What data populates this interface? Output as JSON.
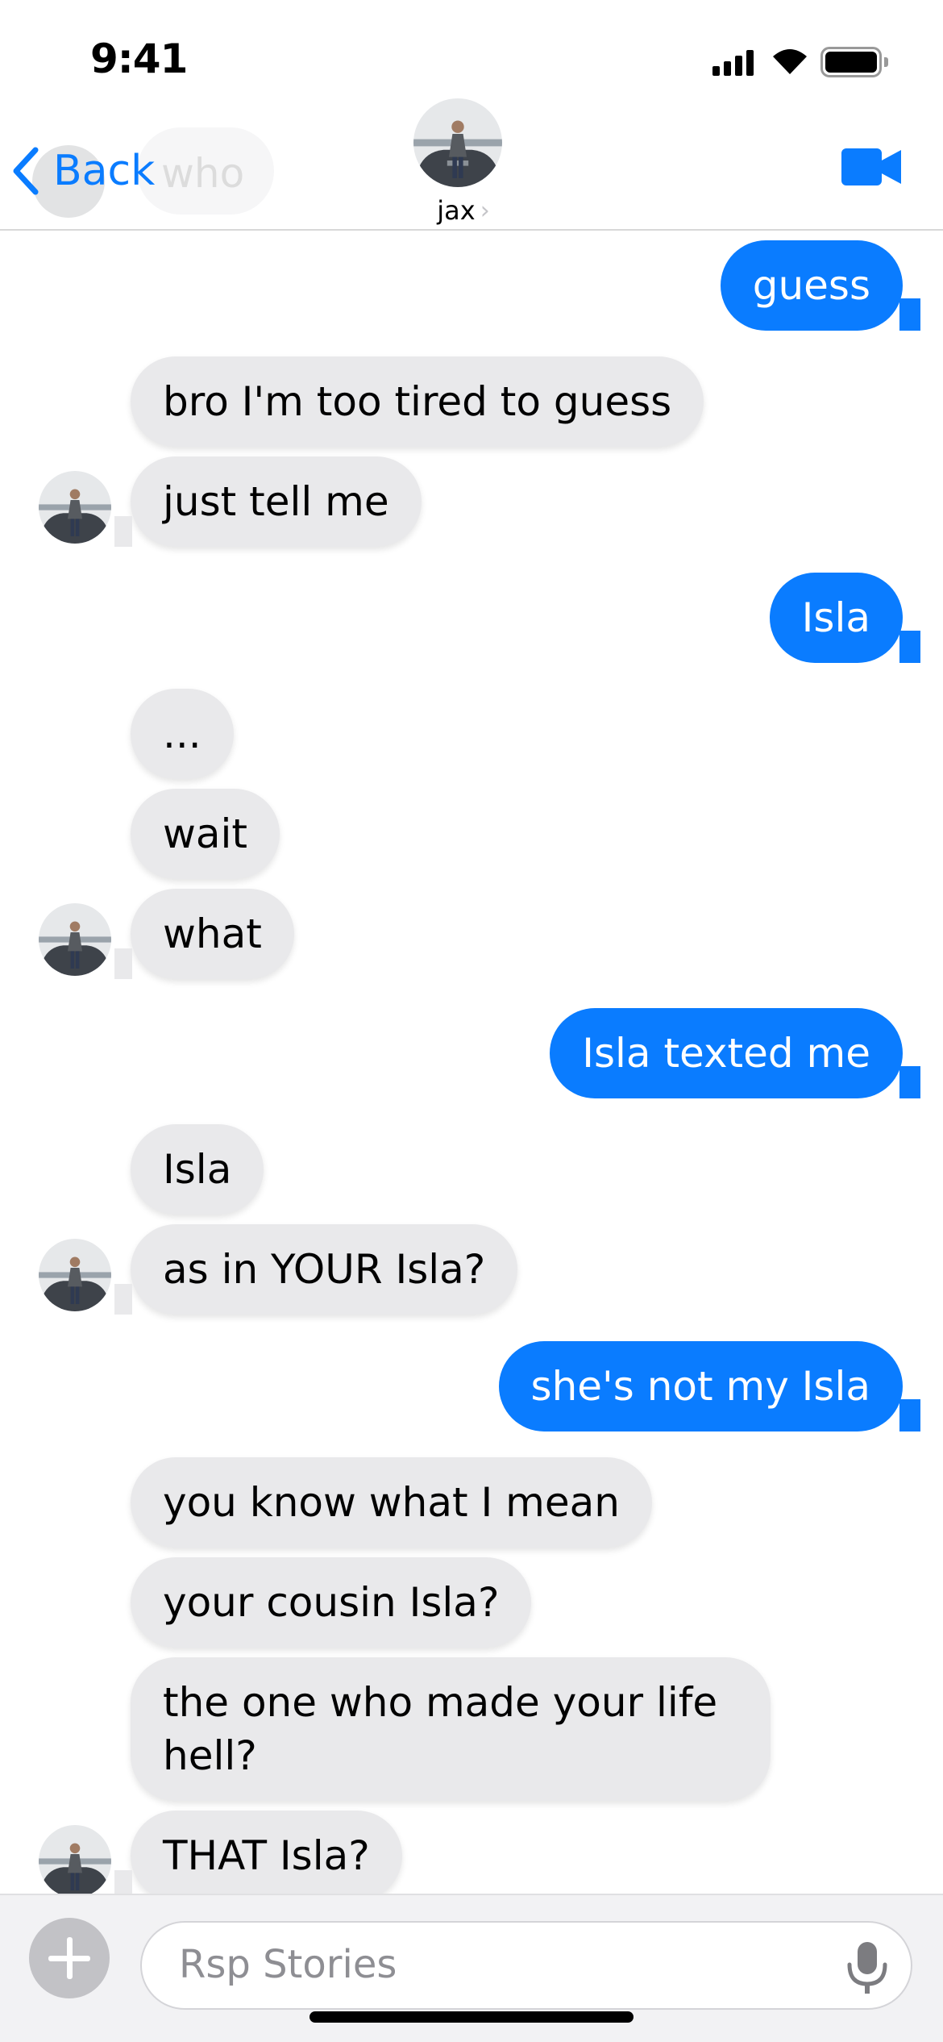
{
  "status": {
    "time": "9:41"
  },
  "header": {
    "back_label": "Back",
    "contact_name": "jax",
    "ghost_text": "who"
  },
  "messages": [
    {
      "dir": "out",
      "text": "guess"
    },
    {
      "dir": "in",
      "text": "bro I'm too tired to guess"
    },
    {
      "dir": "in",
      "text": "just tell me"
    },
    {
      "dir": "out",
      "text": "Isla"
    },
    {
      "dir": "in",
      "text": "..."
    },
    {
      "dir": "in",
      "text": "wait"
    },
    {
      "dir": "in",
      "text": "what"
    },
    {
      "dir": "out",
      "text": "Isla texted me"
    },
    {
      "dir": "in",
      "text": "Isla"
    },
    {
      "dir": "in",
      "text": "as in YOUR Isla?"
    },
    {
      "dir": "out",
      "text": "she's not my Isla"
    },
    {
      "dir": "in",
      "text": "you know what I mean"
    },
    {
      "dir": "in",
      "text": "your cousin Isla?"
    },
    {
      "dir": "in",
      "text": "the one who made your life hell?"
    },
    {
      "dir": "in",
      "text": "THAT Isla?"
    }
  ],
  "composer": {
    "placeholder": "Rsp Stories"
  },
  "colors": {
    "accent": "#0a7cff",
    "incoming_bubble": "#e9e9eb"
  }
}
